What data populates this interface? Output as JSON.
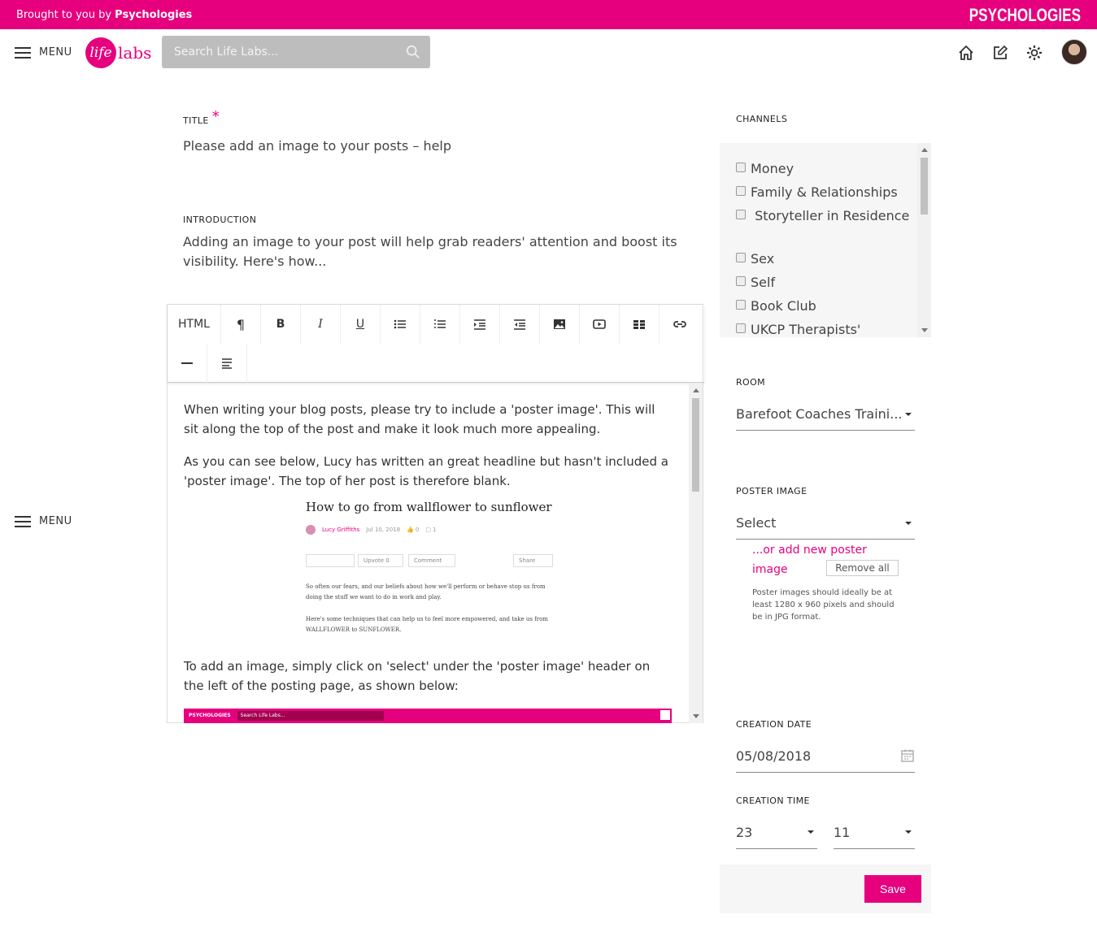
{
  "brand_bar": {
    "brought_prefix": "Brought to you by ",
    "brought_brand": "Psychologies",
    "logo": "PSYCHOLOGIES"
  },
  "header": {
    "menu_label": "MENU",
    "logo_circle": "life",
    "logo_text": "labs",
    "search_placeholder": "Search Life Labs...",
    "icons": [
      "home-icon",
      "edit-icon",
      "settings-icon",
      "avatar"
    ]
  },
  "side_menu": {
    "label": "MENU"
  },
  "form": {
    "title_label": "TITLE",
    "title_required": "*",
    "title_value": "Please add an image to your posts – help",
    "intro_label": "INTRODUCTION",
    "intro_value": "Adding an image to your post will help grab readers' attention and boost its visibility. Here's how..."
  },
  "toolbar": {
    "html": "HTML",
    "buttons": [
      "paragraph-icon",
      "bold-icon",
      "italic-icon",
      "underline-icon",
      "bullet-list-icon",
      "numbered-list-icon",
      "indent-icon",
      "outdent-icon",
      "image-icon",
      "video-icon",
      "table-icon",
      "link-icon",
      "horizontal-rule-icon",
      "align-icon"
    ],
    "bold": "B",
    "italic": "I",
    "underline": "U",
    "paragraph": "¶"
  },
  "editor": {
    "p1": "When writing your blog posts, please try to include a 'poster image'. This will sit along the top of the post and make it look much more appealing.",
    "p2": "As you can see below, Lucy has written an great headline but hasn't included a 'poster image'. The top of her post is therefore blank.",
    "p3": "To add an image, simply click on 'select' under the 'poster image' header on the left of the posting page, as shown below:",
    "embedded_post": {
      "title": "How to go from wallflower to sunflower",
      "author": "Lucy Griffiths",
      "date": "Jul 10, 2018",
      "likes": "0",
      "comments": "1",
      "upvote": "Upvote",
      "upvote_count": "0",
      "comment": "Comment",
      "share": "Share",
      "para1": "So often our fears, and our beliefs about how we'll perform or behave stop us from doing the stuff we want to do in work and play.",
      "para2": "Here's some techniques that can help us to feel more empowered, and take us from WALLFLOWER to SUNFLOWER."
    },
    "embedded_header": {
      "logo": "PSYCHOLOGIES",
      "search": "Search Life Labs..."
    }
  },
  "sidebar": {
    "channels_label": "CHANNELS",
    "channels": [
      "Money",
      "Family & Relationships",
      " Storyteller in Residence",
      "Sex",
      "Self",
      "Book Club",
      "UKCP Therapists'"
    ],
    "room_label": "ROOM",
    "room_value": "Barefoot Coaches Traini...",
    "poster_label": "POSTER IMAGE",
    "poster_value": "Select",
    "add_poster": "...or add new poster image",
    "remove_all": "Remove all",
    "poster_hint": "Poster images should ideally be at least 1280 x 960 pixels and should be in JPG format.",
    "creation_date_label": "CREATION DATE",
    "creation_date": "05/08/2018",
    "creation_time_label": "CREATION TIME",
    "hour": "23",
    "minute": "11",
    "save": "Save"
  },
  "colors": {
    "accent": "#e6007e",
    "search_bg": "#bdbdbd"
  }
}
